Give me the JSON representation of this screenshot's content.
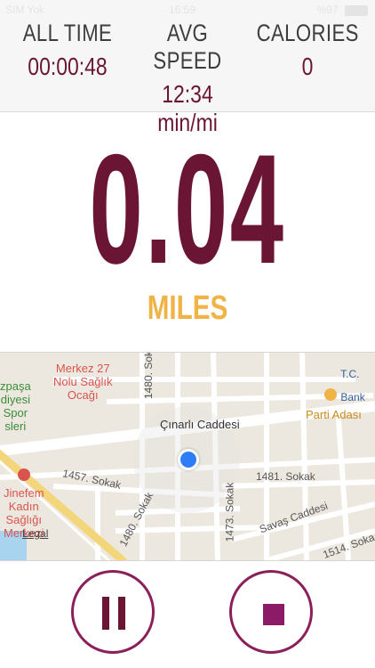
{
  "status_bar": {
    "carrier": "SIM Yok",
    "time": "16:59",
    "battery": "%97"
  },
  "stats": [
    {
      "label": "ALL TIME",
      "value": "00:00:48"
    },
    {
      "label": "AVG SPEED",
      "value": "12:34 min/mi"
    },
    {
      "label": "CALORIES",
      "value": "0"
    }
  ],
  "distance": {
    "value": "0.04",
    "unit": "MILES"
  },
  "map": {
    "streets": {
      "main": "Çınarlı Caddesi",
      "sokak_1457": "1457. Sokak",
      "sokak_1481": "1481. Sokak",
      "sokak_1480_top": "1480. Sok",
      "sokak_1480": "1480. Sokak",
      "sokak_1473": "1473. Sokak",
      "savas": "Savaş Caddesi",
      "sokak_1514": "1514. Soka"
    },
    "pois": {
      "merkez27": "Merkez 27\nNolu Sağlık\nOcağı",
      "parti_adasi": "Parti Adası",
      "jinefem": "Jinefem\nKadın\nSağlığı\nMerkezi",
      "left_edge": "zpaşa\ndiyesi\nSpor\nsleri",
      "bank_top": "T.C.",
      "bank": "Bank"
    },
    "legal": "Legal"
  },
  "controls": {
    "pause": "pause",
    "stop": "stop"
  },
  "colors": {
    "primary": "#6b1535",
    "accent": "#f0b346",
    "control_border": "#8b1f5a",
    "location": "#2f7df6"
  }
}
